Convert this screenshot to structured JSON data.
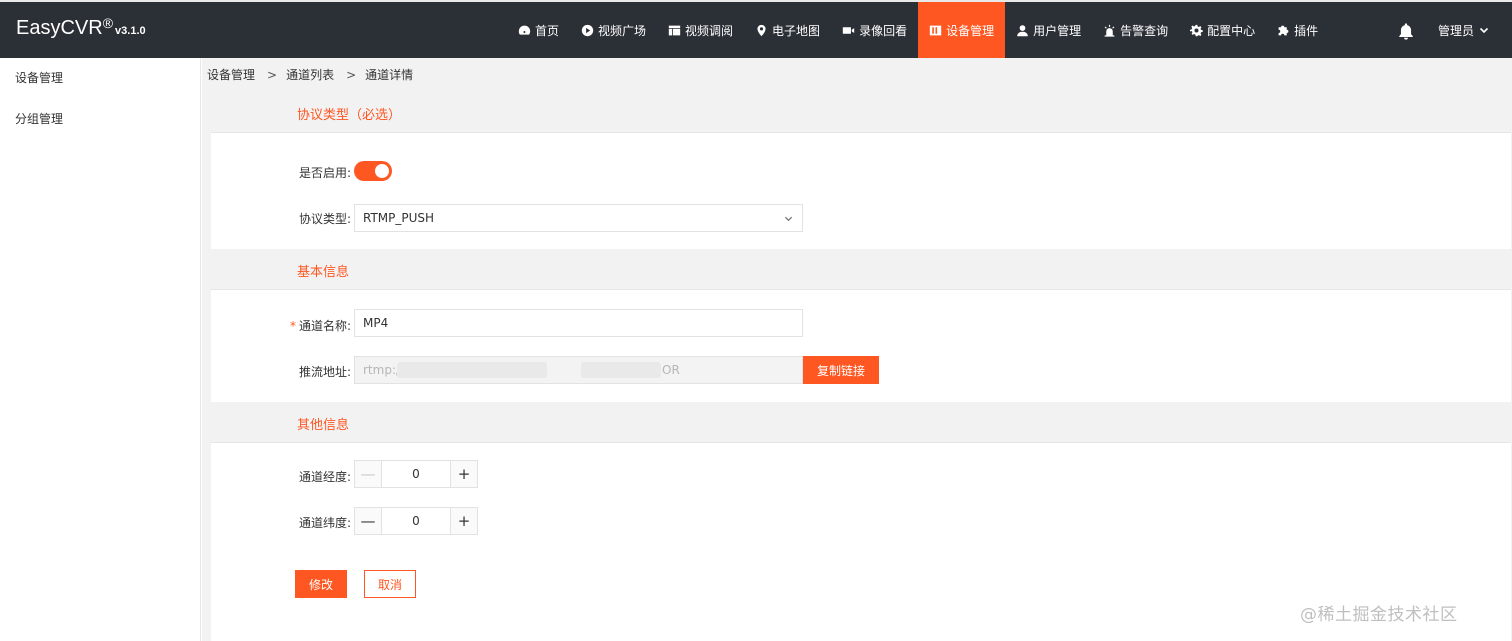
{
  "app": {
    "brand": "EasyCVR",
    "reg_mark": "®",
    "version": "v3.1.0"
  },
  "nav": {
    "items": [
      {
        "label": "首页",
        "icon": "dashboard-icon"
      },
      {
        "label": "视频广场",
        "icon": "play-icon"
      },
      {
        "label": "视频调阅",
        "icon": "layout-icon"
      },
      {
        "label": "电子地图",
        "icon": "location-pin-icon"
      },
      {
        "label": "录像回看",
        "icon": "video-camera-icon"
      },
      {
        "label": "设备管理",
        "icon": "device-icon",
        "active": true
      },
      {
        "label": "用户管理",
        "icon": "user-icon"
      },
      {
        "label": "告警查询",
        "icon": "alarm-icon"
      },
      {
        "label": "配置中心",
        "icon": "gear-icon"
      },
      {
        "label": "插件",
        "icon": "puzzle-icon"
      }
    ],
    "bell_icon": "bell-icon",
    "admin_label": "管理员"
  },
  "sidebar": {
    "items": [
      {
        "label": "设备管理"
      },
      {
        "label": "分组管理"
      }
    ]
  },
  "breadcrumb": {
    "items": [
      "设备管理",
      "通道列表",
      "通道详情"
    ],
    "separator": ">"
  },
  "form": {
    "sections": {
      "protocol": "协议类型（必选）",
      "basic": "基本信息",
      "other": "其他信息"
    },
    "enabled": {
      "label": "是否启用:",
      "value": true
    },
    "protocol_type": {
      "label": "协议类型:",
      "value": "RTMP_PUSH"
    },
    "channel_name": {
      "label": "通道名称:",
      "required_mark": "*",
      "value": "MP4"
    },
    "push_url": {
      "label": "推流地址:",
      "value_prefix": "rtmp://",
      "value_suffix": "OR",
      "copy_label": "复制链接"
    },
    "longitude": {
      "label": "通道经度:",
      "value": "0",
      "minus": "—",
      "plus": "+"
    },
    "latitude": {
      "label": "通道纬度:",
      "value": "0",
      "minus": "—",
      "plus": "+"
    },
    "submit_label": "修改",
    "cancel_label": "取消"
  },
  "watermark": "@稀土掘金技术社区",
  "colors": {
    "accent": "#ff5722",
    "topbar": "#2b2f36"
  }
}
